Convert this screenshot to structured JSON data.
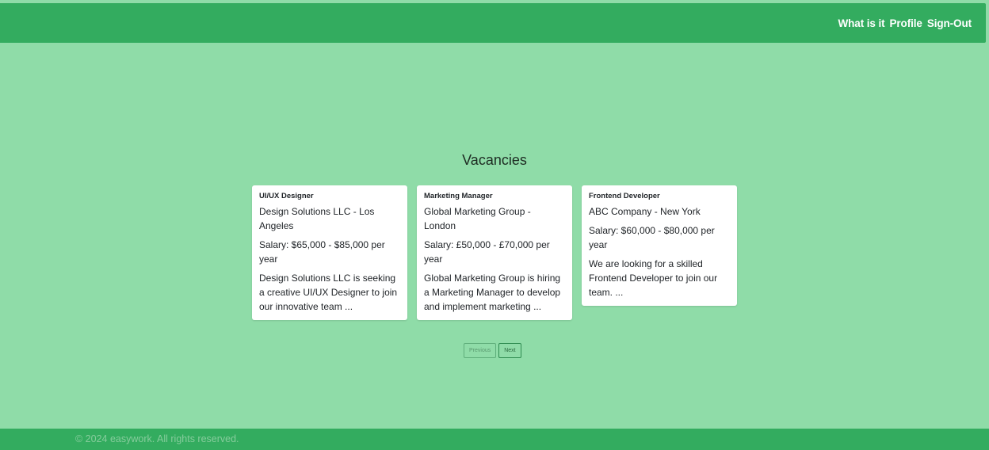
{
  "nav": {
    "links": [
      "What is it",
      "Profile",
      "Sign-Out"
    ]
  },
  "main": {
    "title": "Vacancies",
    "vacancies": [
      {
        "title": "UI/UX Designer",
        "company": "Design Solutions LLC - Los Angeles",
        "salary": "Salary: $65,000 - $85,000 per year",
        "description": "Design Solutions LLC is seeking a creative UI/UX Designer to join our innovative team ..."
      },
      {
        "title": "Marketing Manager",
        "company": "Global Marketing Group - London",
        "salary": "Salary: £50,000 - £70,000 per year",
        "description": "Global Marketing Group is hiring a Marketing Manager to develop and implement marketing ..."
      },
      {
        "title": "Frontend Developer",
        "company": "ABC Company - New York",
        "salary": "Salary: $60,000 - $80,000 per year",
        "description": "We are looking for a skilled Frontend Developer to join our team. ..."
      }
    ]
  },
  "pagination": {
    "previous_label": "Previous",
    "next_label": "Next"
  },
  "footer": {
    "text": "© 2024 easywork. All rights reserved."
  },
  "colors": {
    "background": "#8fdca8",
    "header": "#33ac5f",
    "footer": "#33ac5f"
  }
}
